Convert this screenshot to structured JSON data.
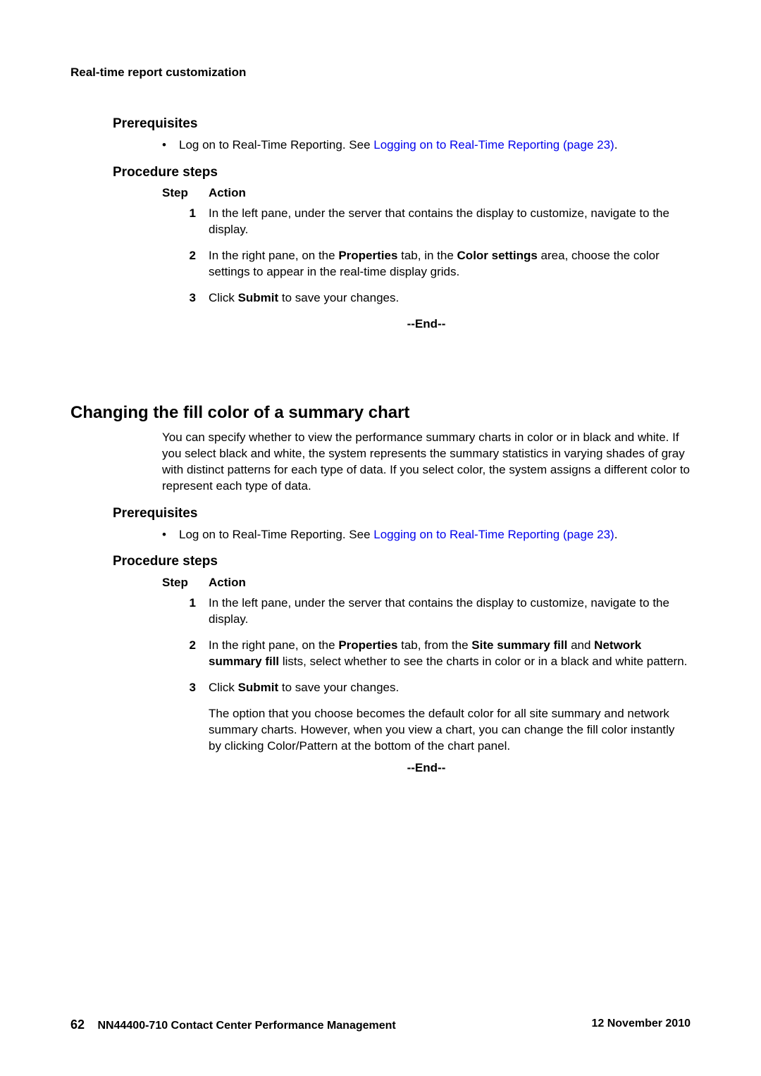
{
  "running_head": "Real-time report customization",
  "section1": {
    "prereq_heading": "Prerequisites",
    "prereq_bullet_prefix": "Log on to Real-Time Reporting. See ",
    "prereq_bullet_link": "Logging on to Real-Time Reporting (page 23)",
    "prereq_bullet_suffix": ".",
    "proc_heading": "Procedure steps",
    "step_header": "Step",
    "action_header": "Action",
    "steps": {
      "s1_num": "1",
      "s1_text": "In the left pane, under the server that contains the display to customize, navigate to the display.",
      "s2_num": "2",
      "s2_pre": "In the right pane, on the ",
      "s2_b1": "Properties",
      "s2_mid1": " tab, in the ",
      "s2_b2": "Color settings",
      "s2_post": " area, choose the color settings to appear in the real-time display grids.",
      "s3_num": "3",
      "s3_pre": "Click ",
      "s3_b": "Submit",
      "s3_post": " to save your changes."
    },
    "end": "--End--"
  },
  "section2": {
    "heading": "Changing the fill color of a summary chart",
    "intro": "You can specify whether to view the performance summary charts in color or in black and white. If you select black and white, the system represents the summary statistics in varying shades of gray with distinct patterns for each type of data. If you select color, the system assigns a different color to represent each type of data.",
    "prereq_heading": "Prerequisites",
    "prereq_bullet_prefix": "Log on to Real-Time Reporting. See ",
    "prereq_bullet_link": "Logging on to Real-Time Reporting (page 23)",
    "prereq_bullet_suffix": ".",
    "proc_heading": "Procedure steps",
    "step_header": "Step",
    "action_header": "Action",
    "steps": {
      "s1_num": "1",
      "s1_text": "In the left pane, under the server that contains the display to customize, navigate to the display.",
      "s2_num": "2",
      "s2_pre": "In the right pane, on the ",
      "s2_b1": "Properties",
      "s2_mid1": " tab, from the ",
      "s2_b2": "Site summary fill",
      "s2_mid2": " and ",
      "s2_b3": "Network summary fill",
      "s2_post": " lists, select whether to see the charts in color or in a black and white pattern.",
      "s3_num": "3",
      "s3_pre": "Click ",
      "s3_b": "Submit",
      "s3_post": " to save your changes.",
      "note": "The option that you choose becomes the default color for all site summary and network summary charts. However, when you view a chart, you can change the fill color instantly by clicking Color/Pattern at the bottom of the chart panel."
    },
    "end": "--End--"
  },
  "footer": {
    "page_number": "62",
    "doc_title": "NN44400-710 Contact Center Performance Management",
    "date": "12 November 2010"
  }
}
